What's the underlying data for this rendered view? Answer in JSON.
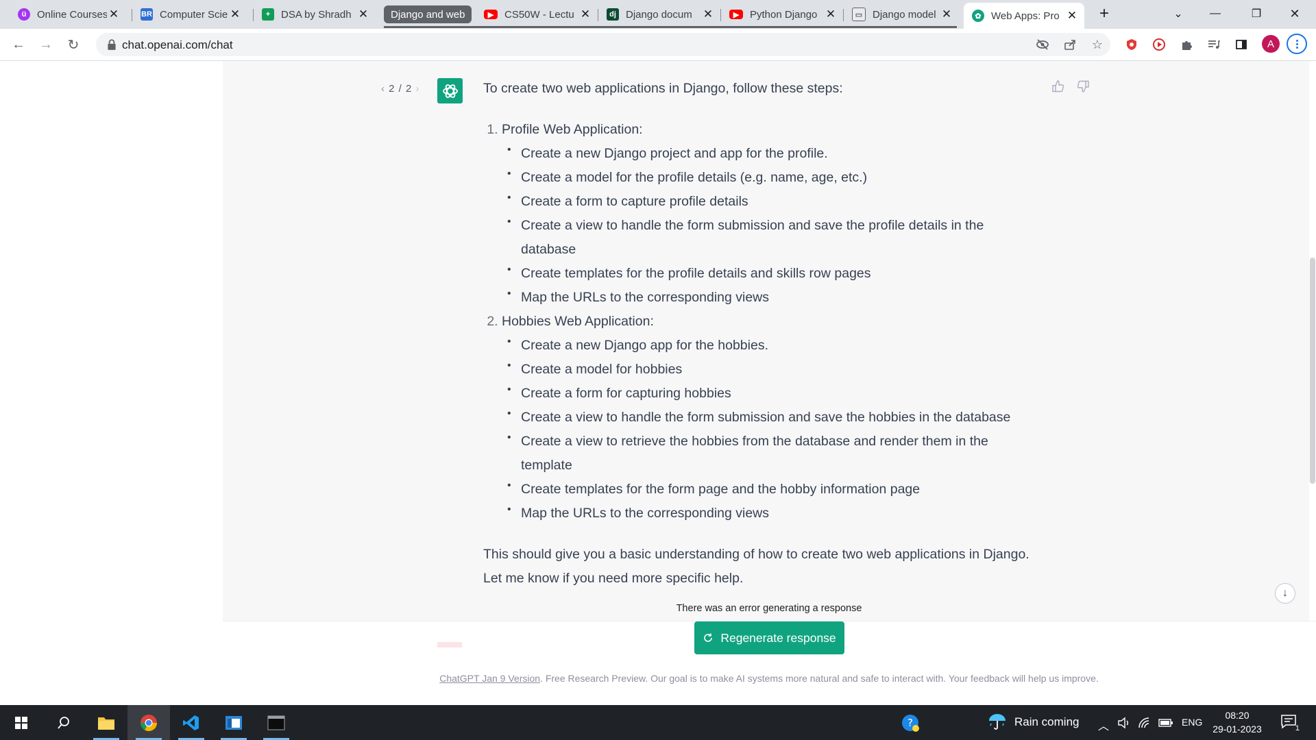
{
  "browser": {
    "tabs": [
      {
        "title": "Online Courses",
        "icon": "udemy-icon",
        "color": "#a435f0"
      },
      {
        "title": "Computer Scie",
        "icon": "br-icon",
        "color": "#2f6fd4"
      },
      {
        "title": "DSA by Shradh",
        "icon": "sheets-icon",
        "color": "#0f9d58"
      },
      {
        "title": "CS50W - Lectu",
        "icon": "youtube-icon",
        "color": "#ff0000"
      },
      {
        "title": "Django docum",
        "icon": "django-icon",
        "color": "#0c4b33"
      },
      {
        "title": "Python Django",
        "icon": "youtube-icon",
        "color": "#ff0000"
      },
      {
        "title": "Django model",
        "icon": "book-icon",
        "color": "#5f6368"
      },
      {
        "title": "Web Apps: Pro",
        "icon": "chatgpt-icon",
        "color": "#10a37f"
      }
    ],
    "tab_group_label": "Django and web",
    "url": "chat.openai.com/chat",
    "profile_initial": "A"
  },
  "conversation": {
    "response_pager": "2 / 2",
    "intro": "To create two web applications in Django, follow these steps:",
    "sections": [
      {
        "title": "Profile Web Application:",
        "items": [
          "Create a new Django project and app for the profile.",
          "Create a model for the profile details (e.g. name, age, etc.)",
          "Create a form to capture profile details",
          "Create a view to handle the form submission and save the profile details in the database",
          "Create templates for the profile details and skills row pages",
          "Map the URLs to the corresponding views"
        ]
      },
      {
        "title": "Hobbies Web Application:",
        "items": [
          "Create a new Django app for the hobbies.",
          "Create a model for hobbies",
          "Create a form for capturing hobbies",
          "Create a view to handle the form submission and save the hobbies in the database",
          "Create a view to retrieve the hobbies from the database and render them in the template",
          "Create templates for the form page and the hobby information page",
          "Map the URLs to the corresponding views"
        ]
      }
    ],
    "outro": "This should give you a basic understanding of how to create two web applications in Django. Let me know if you need more specific help.",
    "error_message": "There was an error generating a response",
    "regenerate_label": "Regenerate response",
    "footer_link": "ChatGPT Jan 9 Version",
    "footer_text": ". Free Research Preview. Our goal is to make AI systems more natural and safe to interact with. Your feedback will help us improve."
  },
  "taskbar": {
    "weather": "Rain coming",
    "language": "ENG",
    "time": "08:20",
    "date": "29-01-2023",
    "notification_count": "1",
    "accent_color": "#76b9ed"
  }
}
